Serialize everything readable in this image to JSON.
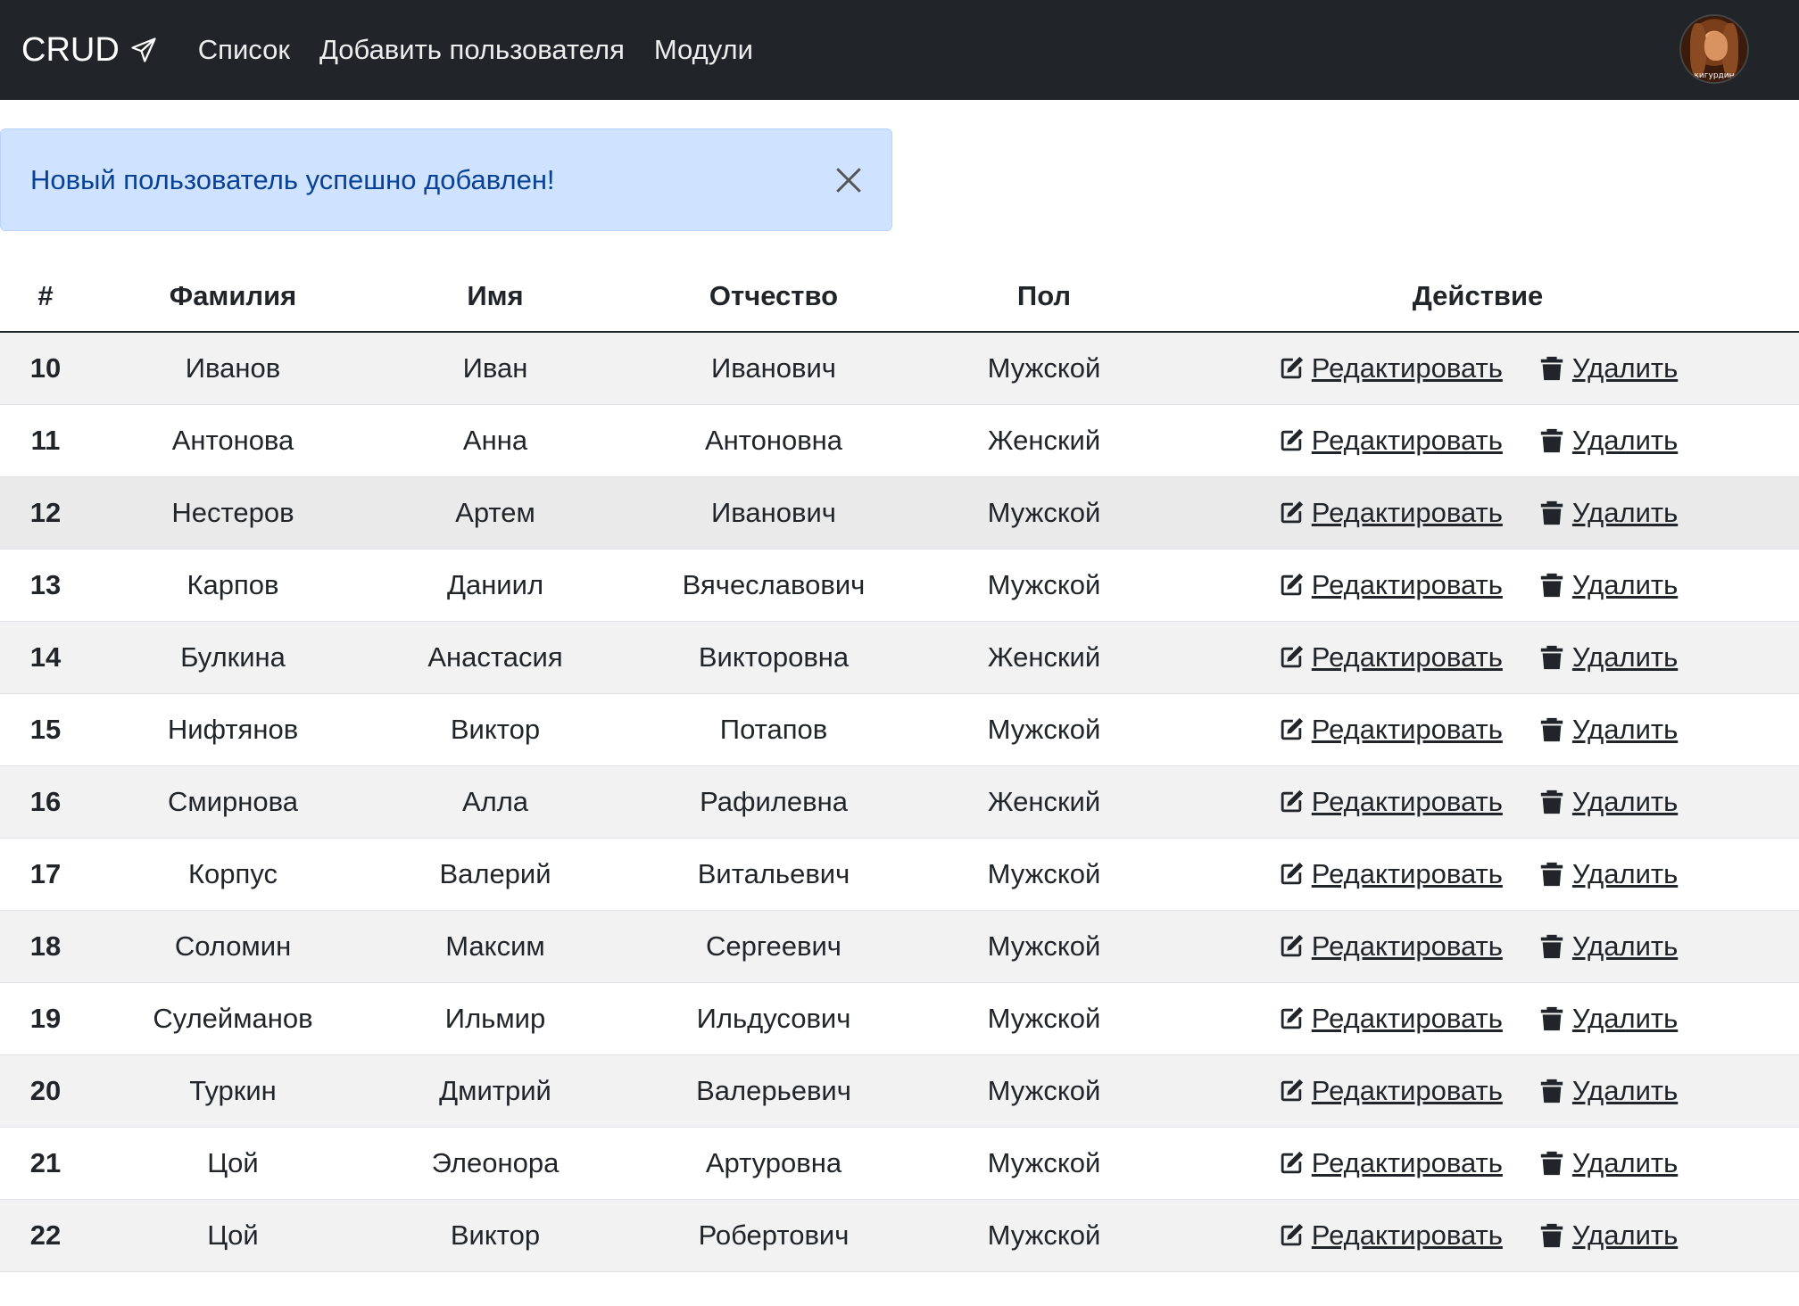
{
  "navbar": {
    "brand": "CRUD",
    "brand_icon": "send-icon",
    "links": [
      "Список",
      "Добавить пользователя",
      "Модули"
    ],
    "avatar_caption": "кигурдин"
  },
  "alert": {
    "message": "Новый пользователь успешно добавлен!",
    "type": "info"
  },
  "table": {
    "headers": [
      "#",
      "Фамилия",
      "Имя",
      "Отчество",
      "Пол",
      "Действие"
    ],
    "edit_label": " Редактировать",
    "delete_label": " Удалить",
    "rows": [
      {
        "id": "10",
        "last": "Иванов",
        "first": "Иван",
        "middle": "Иванович",
        "gender": "Мужской"
      },
      {
        "id": "11",
        "last": "Антонова",
        "first": "Анна",
        "middle": "Антоновна",
        "gender": "Женский"
      },
      {
        "id": "12",
        "last": "Нестеров",
        "first": "Артем",
        "middle": "Иванович",
        "gender": "Мужской"
      },
      {
        "id": "13",
        "last": "Карпов",
        "first": "Даниил",
        "middle": "Вячеславович",
        "gender": "Мужской"
      },
      {
        "id": "14",
        "last": "Булкина",
        "first": "Анастасия",
        "middle": "Викторовна",
        "gender": "Женский"
      },
      {
        "id": "15",
        "last": "Нифтянов",
        "first": "Виктор",
        "middle": "Потапов",
        "gender": "Мужской"
      },
      {
        "id": "16",
        "last": "Смирнова",
        "first": "Алла",
        "middle": "Рафилевна",
        "gender": "Женский"
      },
      {
        "id": "17",
        "last": "Корпус",
        "first": "Валерий",
        "middle": "Витальевич",
        "gender": "Мужской"
      },
      {
        "id": "18",
        "last": "Соломин",
        "first": "Максим",
        "middle": "Сергеевич",
        "gender": "Мужской"
      },
      {
        "id": "19",
        "last": "Сулейманов",
        "first": "Ильмир",
        "middle": "Ильдусович",
        "gender": "Мужской"
      },
      {
        "id": "20",
        "last": "Туркин",
        "first": "Дмитрий",
        "middle": "Валерьевич",
        "gender": "Мужской"
      },
      {
        "id": "21",
        "last": "Цой",
        "first": "Элеонора",
        "middle": "Артуровна",
        "gender": "Мужской"
      },
      {
        "id": "22",
        "last": "Цой",
        "first": "Виктор",
        "middle": "Робертович",
        "gender": "Мужской"
      }
    ]
  },
  "colors": {
    "navbar_bg": "#212529",
    "alert_bg": "#cfe2ff",
    "alert_text": "#084298",
    "stripe": "#f2f2f2"
  }
}
